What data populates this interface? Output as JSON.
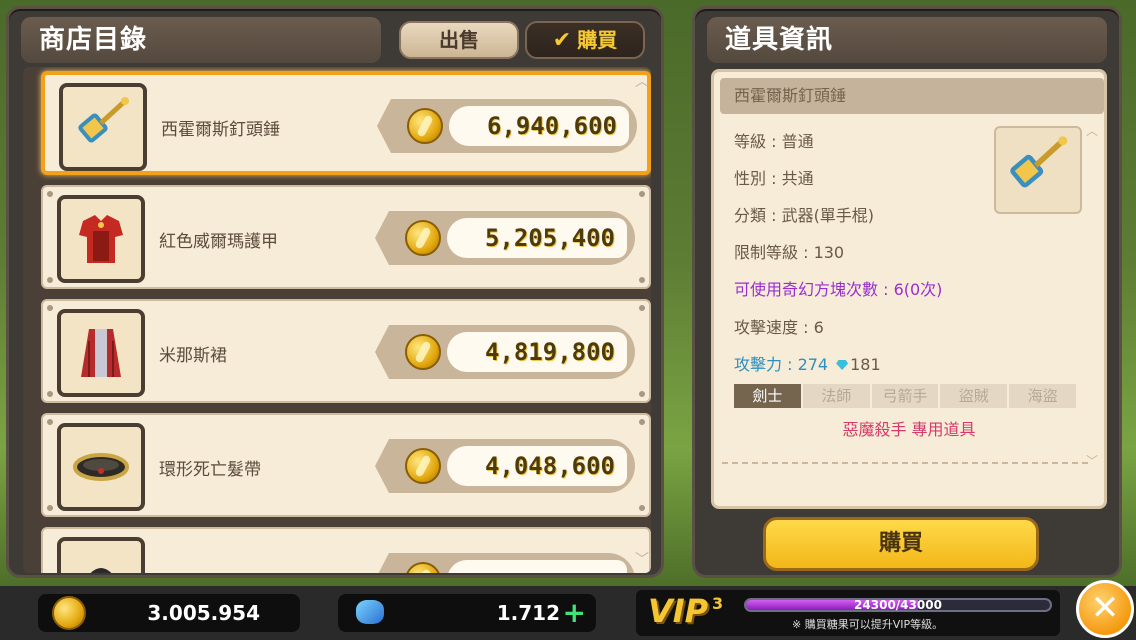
{
  "shop": {
    "title": "商店目錄",
    "tabs": {
      "sell": "出售",
      "buy": "購買"
    },
    "items": [
      {
        "name": "西霍爾斯釘頭錘",
        "price": "6,940,600",
        "icon": "hammer-icon"
      },
      {
        "name": "紅色威爾瑪護甲",
        "price": "5,205,400",
        "icon": "armor-icon"
      },
      {
        "name": "米那斯裙",
        "price": "4,819,800",
        "icon": "skirt-icon"
      },
      {
        "name": "環形死亡髮帶",
        "price": "4,048,600",
        "icon": "headband-icon"
      },
      {
        "name": "",
        "price": "",
        "icon": "helmet-icon"
      }
    ]
  },
  "info": {
    "title": "道具資訊",
    "item_name": "西霍爾斯釘頭錘",
    "level": "等級 : 普通",
    "gender": "性別 : 共通",
    "category": "分類 : 武器(單手棍)",
    "req_level": "限制等級 : 130",
    "cube": "可使用奇幻方塊次數 : 6(0次)",
    "atk_speed": "攻擊速度 : 6",
    "atk_power": "攻擊力 : 274",
    "atk_bonus": "181",
    "classes": [
      "劍士",
      "法師",
      "弓箭手",
      "盜賊",
      "海盜"
    ],
    "exclusive": "惡魔殺手 專用道具",
    "buy_button": "購買"
  },
  "wallet": {
    "mesos": "3.005.954",
    "candy": "1.712",
    "vip": {
      "logo": "VIP",
      "level": "3",
      "progress_text": "24300/43000",
      "progress": 0.565,
      "note": "※ 購買糖果可以提升VIP等級。"
    }
  },
  "colors": {
    "accent": "#f3a01a",
    "price_gold": "#f1c64a",
    "cube_purple": "#9a2ed1",
    "attack_blue": "#2c8fbf"
  }
}
